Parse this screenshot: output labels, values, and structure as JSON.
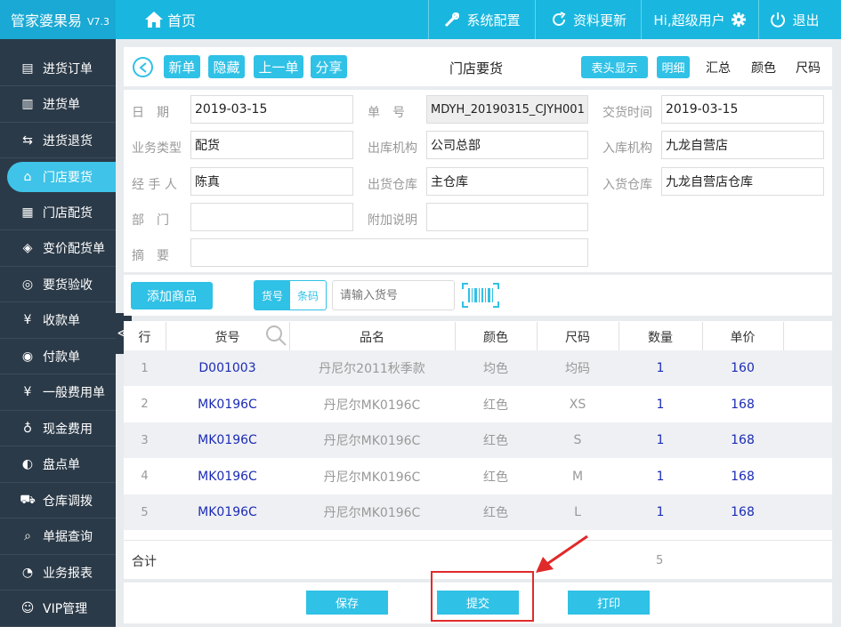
{
  "topbar": {
    "brand": "管家婆果易",
    "version": "V7.3",
    "home_label": "首页",
    "system_config": "系统配置",
    "data_update": "资料更新",
    "user_greeting": "Hi,超级用户",
    "logout": "退出"
  },
  "sidebar": {
    "items": [
      {
        "label": "进货订单",
        "icon": "order-icon"
      },
      {
        "label": "进货单",
        "icon": "document-icon"
      },
      {
        "label": "进货退货",
        "icon": "return-icon"
      },
      {
        "label": "门店要货",
        "icon": "store-icon"
      },
      {
        "label": "门店配货",
        "icon": "distribution-icon"
      },
      {
        "label": "变价配货单",
        "icon": "price-tag-icon"
      },
      {
        "label": "要货验收",
        "icon": "inspect-icon"
      },
      {
        "label": "收款单",
        "icon": "receipt-icon"
      },
      {
        "label": "付款单",
        "icon": "payment-icon"
      },
      {
        "label": "一般费用单",
        "icon": "yen-icon"
      },
      {
        "label": "现金费用",
        "icon": "money-bag-icon"
      },
      {
        "label": "盘点单",
        "icon": "inventory-icon"
      },
      {
        "label": "仓库调拨",
        "icon": "cart-icon"
      },
      {
        "label": "单据查询",
        "icon": "search-icon"
      },
      {
        "label": "业务报表",
        "icon": "pie-chart-icon"
      },
      {
        "label": "VIP管理",
        "icon": "user-icon"
      }
    ],
    "active_index": 3,
    "collapse_glyph": "≪"
  },
  "header": {
    "new_btn": "新单",
    "hide_btn": "隐藏",
    "prev_btn": "上一单",
    "share_btn": "分享",
    "title": "门店要货",
    "header_display": "表头显示",
    "detail": "明细",
    "summary": "汇总",
    "color": "颜色",
    "size": "尺码"
  },
  "form": {
    "date_label": "日　期",
    "date_value": "2019-03-15",
    "number_label": "单　号",
    "number_value": "MDYH_20190315_CJYH001",
    "delivery_time_label": "交货时间",
    "delivery_time_value": "2019-03-15",
    "biz_type_label": "业务类型",
    "biz_type_value": "配货",
    "out_org_label": "出库机构",
    "out_org_value": "公司总部",
    "in_org_label": "入库机构",
    "in_org_value": "九龙自营店",
    "handler_label": "经 手 人",
    "handler_value": "陈真",
    "out_wh_label": "出货仓库",
    "out_wh_value": "主仓库",
    "in_wh_label": "入货仓库",
    "in_wh_value": "九龙自营店仓库",
    "dept_label": "部　门",
    "dept_value": "",
    "extra_label": "附加说明",
    "extra_value": "",
    "memo_label": "摘　要",
    "memo_value": ""
  },
  "toolbar": {
    "add_product": "添加商品",
    "seg_code": "货号",
    "seg_barcode": "条码",
    "search_placeholder": "请输入货号"
  },
  "table": {
    "columns": [
      "行",
      "货号",
      "品名",
      "颜色",
      "尺码",
      "数量",
      "单价"
    ],
    "rows": [
      {
        "idx": "1",
        "code": "D001003",
        "name": "丹尼尔2011秋季款",
        "color": "均色",
        "size": "均码",
        "qty": "1",
        "price": "160"
      },
      {
        "idx": "2",
        "code": "MK0196C",
        "name": "丹尼尔MK0196C",
        "color": "红色",
        "size": "XS",
        "qty": "1",
        "price": "168"
      },
      {
        "idx": "3",
        "code": "MK0196C",
        "name": "丹尼尔MK0196C",
        "color": "红色",
        "size": "S",
        "qty": "1",
        "price": "168"
      },
      {
        "idx": "4",
        "code": "MK0196C",
        "name": "丹尼尔MK0196C",
        "color": "红色",
        "size": "M",
        "qty": "1",
        "price": "168"
      },
      {
        "idx": "5",
        "code": "MK0196C",
        "name": "丹尼尔MK0196C",
        "color": "红色",
        "size": "L",
        "qty": "1",
        "price": "168"
      }
    ],
    "total_label": "合计",
    "total_qty": "5"
  },
  "footer": {
    "save": "保存",
    "submit": "提交",
    "print": "打印"
  },
  "colors": {
    "accent": "#30c1e6",
    "topbar": "#19b7df",
    "sidebar": "#2b3a48",
    "link_blue": "#1c2bb5",
    "annotation_red": "#e02a2a"
  }
}
